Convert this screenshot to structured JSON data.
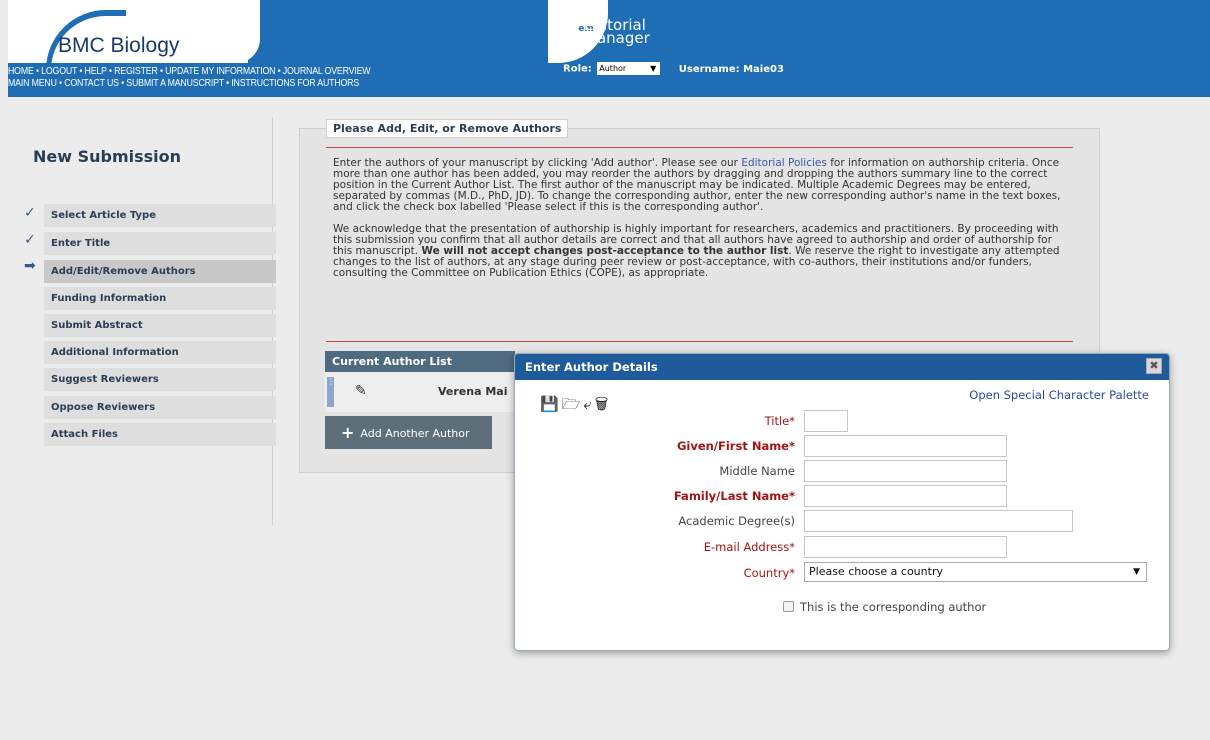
{
  "header": {
    "journal_name": "BMC Biology",
    "em_badge": "em",
    "em_title_line1": "Editorial",
    "em_title_line2": "Manager",
    "nav_line1": "HOME • LOGOUT • HELP • REGISTER • UPDATE MY INFORMATION • JOURNAL OVERVIEW",
    "nav_line2": "MAIN MENU • CONTACT US • SUBMIT A MANUSCRIPT • INSTRUCTIONS FOR AUTHORS",
    "role_label": "Role:",
    "role_value": "Author",
    "username_label": "Username: Maie03"
  },
  "sidebar": {
    "title": "New Submission",
    "items": [
      {
        "label": "Select Article Type",
        "mark": "✓"
      },
      {
        "label": "Enter Title",
        "mark": "✓"
      },
      {
        "label": "Add/Edit/Remove Authors",
        "mark": "➡"
      },
      {
        "label": "Funding Information",
        "mark": ""
      },
      {
        "label": "Submit Abstract",
        "mark": ""
      },
      {
        "label": "Additional Information",
        "mark": ""
      },
      {
        "label": "Suggest Reviewers",
        "mark": ""
      },
      {
        "label": "Oppose Reviewers",
        "mark": ""
      },
      {
        "label": "Attach Files",
        "mark": ""
      }
    ]
  },
  "main": {
    "section_title": "Please Add, Edit, or Remove Authors",
    "para1_a": "Enter the authors of your manuscript by clicking 'Add author'. Please see our ",
    "para1_link": "Editorial Policies",
    "para1_b": " for information on authorship criteria. Once more than one author has been added, you may reorder the authors by dragging and dropping the authors summary line to the correct position in the Current Author List. The first author of the manuscript may be indicated. Multiple Academic Degrees may be entered, separated by commas (M.D., PhD, JD). To change the corresponding author, enter the new corresponding author's name in the text boxes, and click the check box labelled 'Please select if this is the corresponding author'.",
    "para2_a": "We acknowledge that the presentation of authorship is highly important for researchers, academics and practitioners. By proceeding with this submission you confirm that all author details are correct and that all authors have agreed to authorship and order of authorship for this manuscript. ",
    "para2_bold": "We will not accept changes post-acceptance to the author list",
    "para2_b": ". We reserve the right to investigate any attempted changes to the list of authors, at any stage during peer review or post-acceptance, with co-authors, their institutions and/or funders, consulting the Committee on Publication Ethics (COPE), as appropriate.",
    "author_list_header": "Current Author List",
    "author_name": "Verena Mai",
    "add_author_label": "Add Another Author"
  },
  "modal": {
    "title": "Enter Author Details",
    "close_glyph": "✖",
    "special_chars_link": "Open Special Character Palette",
    "fields": {
      "title": "Title*",
      "given_name": "Given/First Name*",
      "middle_name": "Middle Name",
      "family_name": "Family/Last Name*",
      "degrees": "Academic Degree(s)",
      "email": "E-mail Address*",
      "country": "Country*"
    },
    "country_value": "Please choose a country",
    "corresponding_label": "This is the corresponding author"
  }
}
